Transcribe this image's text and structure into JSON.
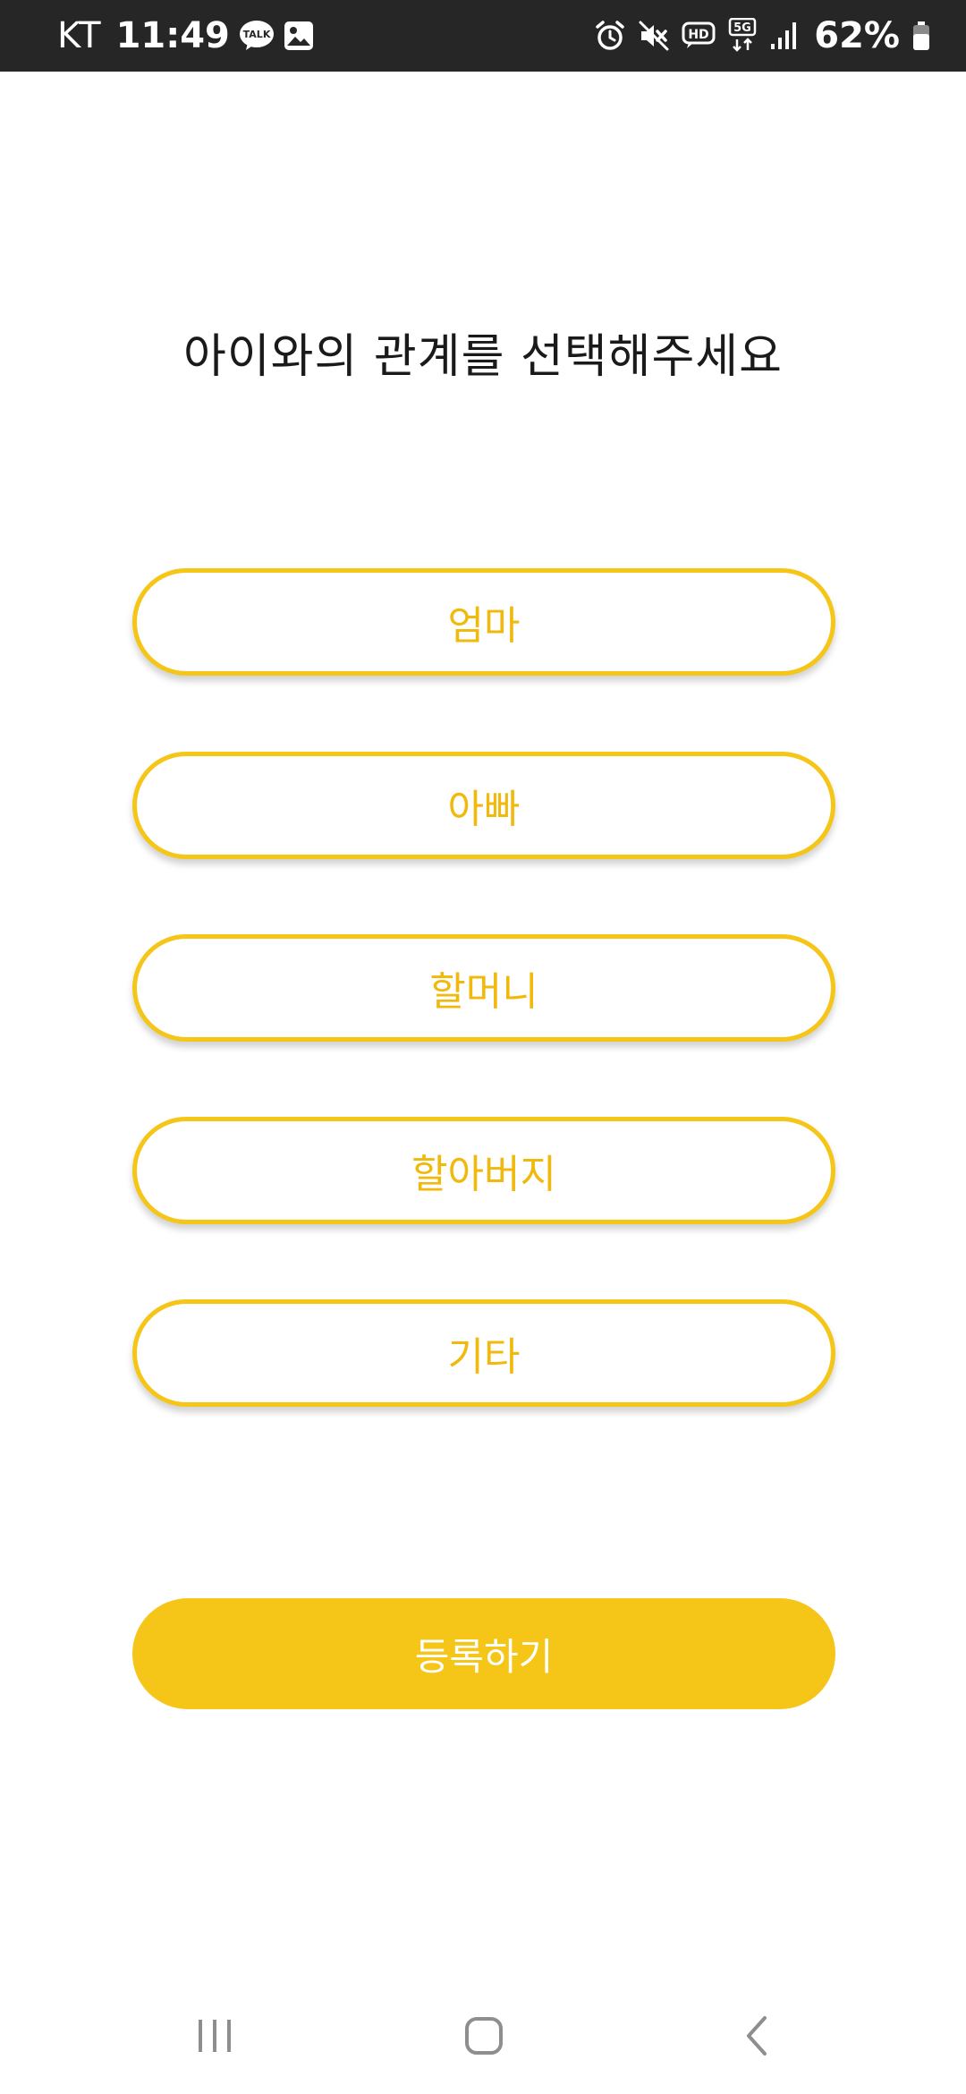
{
  "status_bar": {
    "carrier": "KT",
    "time": "11:49",
    "battery": "62%",
    "icons_left": [
      "kakaotalk-icon",
      "gallery-icon"
    ],
    "icons_right": [
      "alarm-icon",
      "mute-icon",
      "hd-icon",
      "5g-icon",
      "signal-icon",
      "battery-icon"
    ],
    "talk_label": "TALK",
    "hd_label": "HD",
    "net_label": "5G"
  },
  "page": {
    "title": "아이와의 관계를 선택해주세요"
  },
  "options": [
    {
      "label": "엄마"
    },
    {
      "label": "아빠"
    },
    {
      "label": "할머니"
    },
    {
      "label": "할아버지"
    },
    {
      "label": "기타"
    }
  ],
  "register_button": {
    "label": "등록하기"
  },
  "colors": {
    "accent": "#f5c518",
    "option_text": "#f0b90b",
    "status_bar_bg": "#262626"
  },
  "nav_bar": {
    "buttons": [
      "recent-apps-icon",
      "home-icon",
      "back-icon"
    ]
  }
}
